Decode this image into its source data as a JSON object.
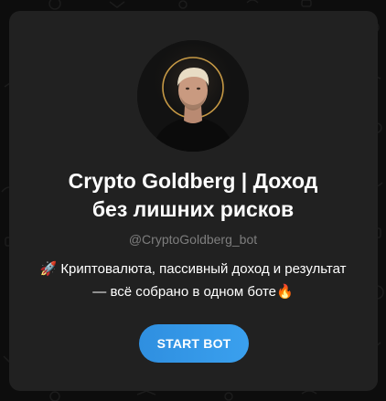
{
  "bot": {
    "name_line1": "Crypto Goldberg | Доход",
    "name_line2": "без лишних рисков",
    "username": "@CryptoGoldberg_bot",
    "description_line1": "🚀 Криптовалюта, пассивный доход и результат",
    "description_line2": "— всё собрано в одном боте🔥"
  },
  "actions": {
    "start_label": "START BOT"
  },
  "colors": {
    "page_background": "#0d0d0d",
    "card_background": "#212121",
    "button_blue": "#3390ec",
    "muted_text": "#7e7e7e",
    "avatar_ring": "#d9a74a"
  },
  "icons": {
    "avatar": "profile-photo"
  }
}
